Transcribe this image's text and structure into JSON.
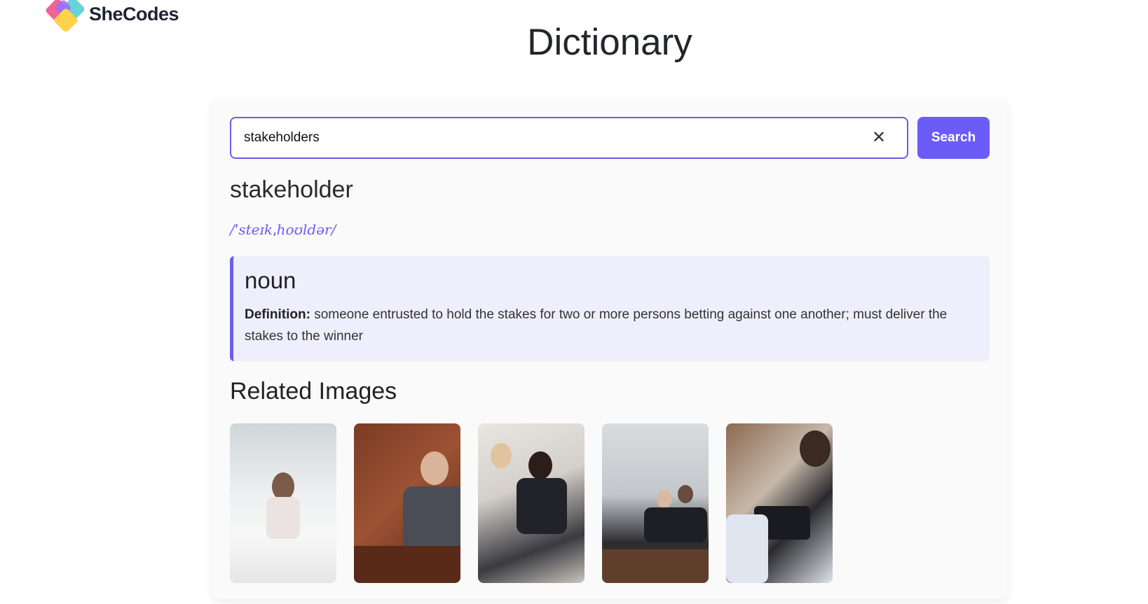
{
  "logo": {
    "text": "SheCodes"
  },
  "title": "Dictionary",
  "search": {
    "value": "stakeholders",
    "button_label": "Search",
    "clear_icon": "close-icon"
  },
  "result": {
    "word": "stakeholder",
    "phonetic": "/ˈsteɪkˌhoʊldər/",
    "meanings": [
      {
        "part_of_speech": "noun",
        "definition_label": "Definition:",
        "definition": "someone entrusted to hold the stakes for two or more persons betting against one another; must deliver the stakes to the winner"
      }
    ]
  },
  "related_images": {
    "heading": "Related Images",
    "count": 5
  },
  "colors": {
    "accent": "#6b5cf0",
    "meaning_bg": "#efeefd",
    "card_bg": "#fafafa"
  }
}
